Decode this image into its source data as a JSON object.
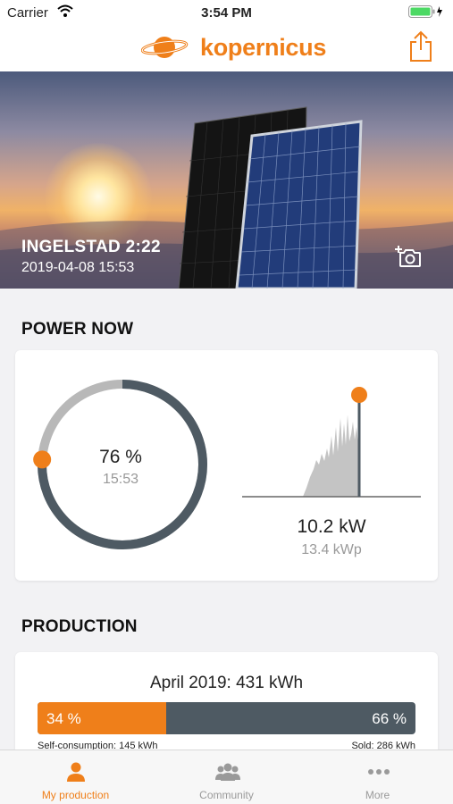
{
  "status_bar": {
    "carrier": "Carrier",
    "time": "3:54 PM"
  },
  "header": {
    "logo_text": "kopernicus",
    "share_icon": "share-icon"
  },
  "hero": {
    "title": "INGELSTAD 2:22",
    "date": "2019-04-08 15:53",
    "camera_icon": "add-photo-icon"
  },
  "power_now": {
    "title": "POWER NOW",
    "percent": "76 %",
    "percent_value": 76,
    "time": "15:53",
    "power": "10.2 kW",
    "peak": "13.4 kWp"
  },
  "production": {
    "title": "PRODUCTION",
    "period": "April 2019: 431 kWh",
    "self_percent": "34 %",
    "sold_percent": "66 %",
    "self_share": 34,
    "self_consumption": "Self-consumption: 145 kWh",
    "sold": "Sold: 286 kWh"
  },
  "tabs": [
    {
      "label": "My production",
      "icon": "person-icon",
      "active": true
    },
    {
      "label": "Community",
      "icon": "group-icon",
      "active": false
    },
    {
      "label": "More",
      "icon": "more-dots-icon",
      "active": false
    }
  ],
  "colors": {
    "accent": "#ef7f1a",
    "dark": "#4e5a63",
    "track": "#b8b8b8"
  }
}
